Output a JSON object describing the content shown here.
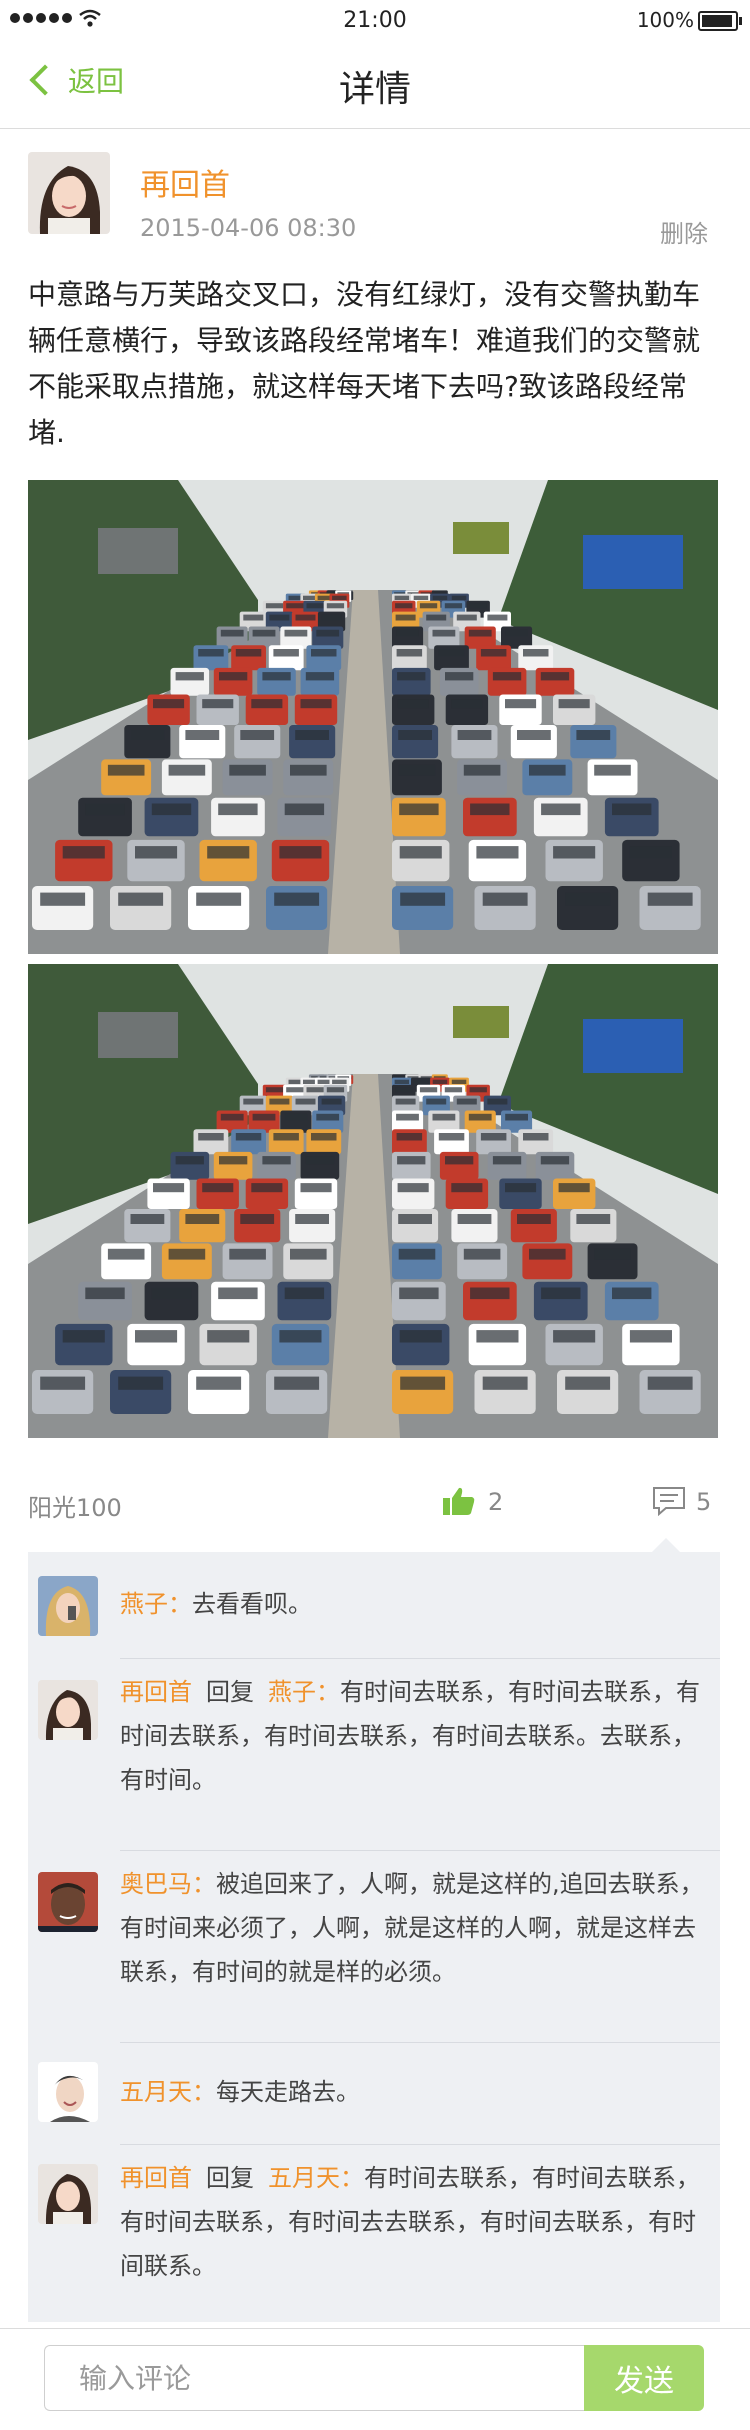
{
  "status_bar": {
    "time": "21:00",
    "battery": "100%"
  },
  "nav": {
    "back_label": "返回",
    "title": "详情"
  },
  "post": {
    "author": "再回首",
    "time": "2015-04-06  08:30",
    "delete_label": "删除",
    "content": "中意路与万芙路交叉口，没有红绿灯，没有交警执勤车辆任意横行，导致该路段经常堵车！难道我们的交警就不能采取点措施，就这样每天堵下去吗?致该路段经常堵.",
    "source_user": "阳光100",
    "like_count": "2",
    "comment_count": "5"
  },
  "comments": [
    {
      "author": "燕子：",
      "reply_label": "",
      "reply_to": "",
      "text": "去看看呗。"
    },
    {
      "author": "再回首",
      "reply_label": "回复",
      "reply_to": "燕子：",
      "text": "有时间去联系，有时间去联系，有时间去联系，有时间去联系，有时间去联系。去联系，有时间。"
    },
    {
      "author": "奥巴马：",
      "reply_label": "",
      "reply_to": "",
      "text": "被追回来了，人啊，就是这样的,追回去联系，有时间来必须了，人啊，就是这样的人啊，就是这样去联系，有时间的就是样的必须。"
    },
    {
      "author": "五月天：",
      "reply_label": "",
      "reply_to": "",
      "text": "每天走路去。"
    },
    {
      "author": "再回首",
      "reply_label": "回复",
      "reply_to": "五月天：",
      "text": "有时间去联系，有时间去联系，有时间去联系，有时间去去联系，有时间去联系，有时间联系。"
    }
  ],
  "input": {
    "placeholder": "输入评论",
    "send_label": "发送"
  },
  "colors": {
    "accent_green": "#7cc241",
    "name_orange": "#f0922c",
    "panel_bg": "#eef0f3",
    "send_bg": "#a6d86c"
  }
}
